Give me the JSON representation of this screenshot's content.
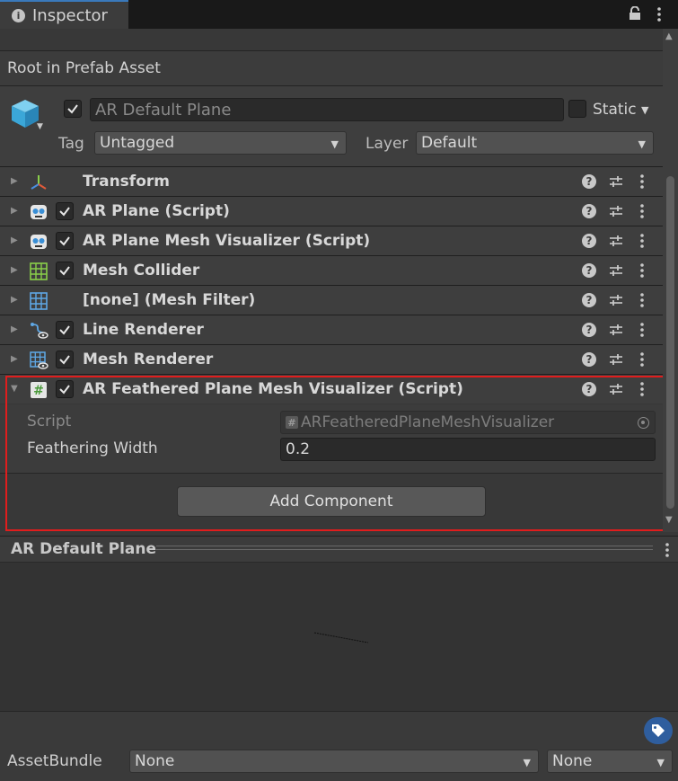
{
  "tab": {
    "title": "Inspector"
  },
  "prefab_bar": {
    "text": "Root in Prefab Asset"
  },
  "gameobject": {
    "name": "AR Default Plane",
    "active": true,
    "static_label": "Static",
    "static_checked": false,
    "tag_label": "Tag",
    "tag_value": "Untagged",
    "layer_label": "Layer",
    "layer_value": "Default"
  },
  "components": [
    {
      "name": "Transform",
      "icon": "transform-icon",
      "has_toggle": false,
      "expanded": false
    },
    {
      "name": "AR Plane (Script)",
      "icon": "script-face-icon",
      "has_toggle": true,
      "expanded": false
    },
    {
      "name": "AR Plane Mesh Visualizer (Script)",
      "icon": "script-face-icon",
      "has_toggle": true,
      "expanded": false
    },
    {
      "name": "Mesh Collider",
      "icon": "mesh-collider-icon",
      "has_toggle": true,
      "expanded": false
    },
    {
      "name": "[none] (Mesh Filter)",
      "icon": "mesh-filter-icon",
      "has_toggle": false,
      "expanded": false
    },
    {
      "name": "Line Renderer",
      "icon": "line-renderer-icon",
      "has_toggle": true,
      "expanded": false
    },
    {
      "name": "Mesh Renderer",
      "icon": "mesh-renderer-icon",
      "has_toggle": true,
      "expanded": false
    },
    {
      "name": "AR Feathered Plane Mesh Visualizer (Script)",
      "icon": "script-hash-icon",
      "has_toggle": true,
      "expanded": true
    }
  ],
  "expanded_component": {
    "script_label": "Script",
    "script_value": "ARFeatheredPlaneMeshVisualizer",
    "feathering_label": "Feathering Width",
    "feathering_value": "0.2"
  },
  "add_component_label": "Add Component",
  "preview": {
    "title": "AR Default Plane"
  },
  "asset_bundle": {
    "label": "AssetBundle",
    "name_value": "None",
    "variant_value": "None"
  },
  "colors": {
    "highlight": "#e01d1d",
    "accent": "#3a79bb",
    "tag_icon": "#2f5e9e"
  }
}
